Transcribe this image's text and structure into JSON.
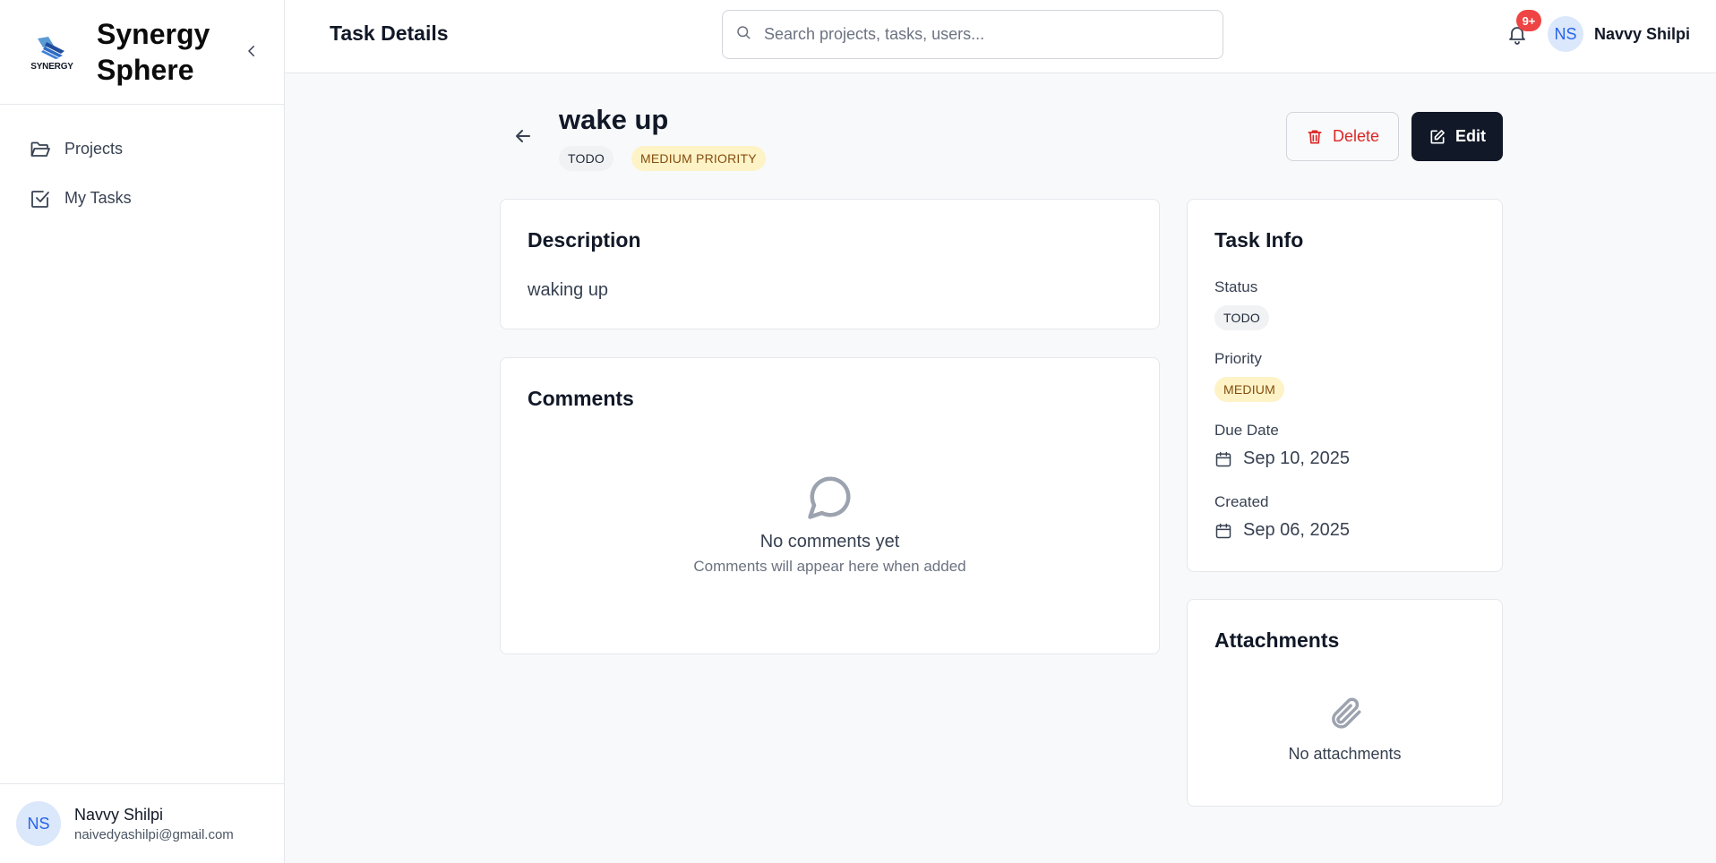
{
  "sidebar": {
    "logo_text": "SYNERGY",
    "brand_line1": "Synergy",
    "brand_line2": "Sphere",
    "items": [
      {
        "label": "Projects",
        "icon": "folder-icon"
      },
      {
        "label": "My Tasks",
        "icon": "checkbox-icon"
      }
    ],
    "user": {
      "initials": "NS",
      "name": "Navvy Shilpi",
      "email": "naivedyashilpi@gmail.com"
    }
  },
  "header": {
    "title": "Task Details",
    "search_placeholder": "Search projects, tasks, users...",
    "notification_count": "9+",
    "user_initials": "NS",
    "user_name": "Navvy Shilpi"
  },
  "task": {
    "title": "wake up",
    "status_pill": "TODO",
    "priority_pill": "MEDIUM PRIORITY",
    "delete_label": "Delete",
    "edit_label": "Edit"
  },
  "description": {
    "heading": "Description",
    "text": "waking up"
  },
  "comments": {
    "heading": "Comments",
    "empty_title": "No comments yet",
    "empty_sub": "Comments will appear here when added"
  },
  "info": {
    "heading": "Task Info",
    "status_label": "Status",
    "status_value": "TODO",
    "priority_label": "Priority",
    "priority_value": "MEDIUM",
    "due_label": "Due Date",
    "due_value": "Sep 10, 2025",
    "created_label": "Created",
    "created_value": "Sep 06, 2025"
  },
  "attachments": {
    "heading": "Attachments",
    "empty_text": "No attachments"
  },
  "colors": {
    "accent_dark": "#111827",
    "danger": "#dc2626",
    "priority_bg": "#fef3c7",
    "badge": "#ef4444",
    "avatar_bg": "#dbe7fb"
  }
}
